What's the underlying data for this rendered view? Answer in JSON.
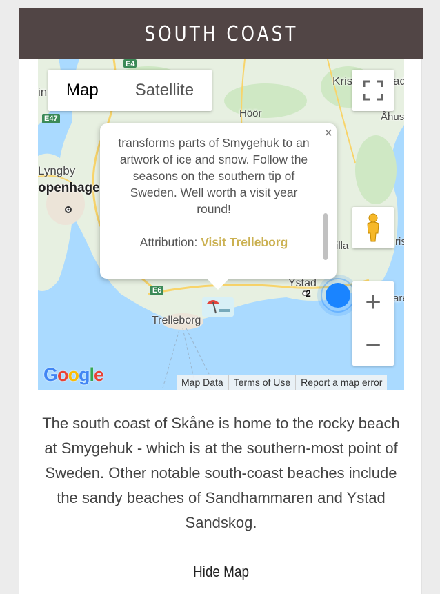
{
  "header": {
    "title": "SOUTH COAST"
  },
  "map": {
    "map_type": {
      "map_label": "Map",
      "satellite_label": "Satellite",
      "active": "Map"
    },
    "controls": {
      "fullscreen_icon": "fullscreen-icon",
      "pegman_icon": "pegman-icon",
      "zoom_in": "+",
      "zoom_out": "−"
    },
    "popup": {
      "text": "transforms parts of Smygehuk to an artwork of ice and snow. Follow the seasons on the southern tip of Sweden. Well worth a visit year round!",
      "attribution_label": "Attribution:",
      "attribution_link": "Visit Trelleborg",
      "close": "×",
      "link_color": "#cbb152"
    },
    "labels": {
      "kris": "Kris",
      "ad": "ad",
      "in": "in",
      "hoor": "Höör",
      "ahus": "Åhus",
      "lyngby": "Lyngby",
      "copenhagen": "openhage",
      "illa": "illa",
      "ris": "ris",
      "ystad": "Ystad",
      "trelleborg": "Trelleborg",
      "are": "are",
      "cluster_count": "2"
    },
    "road_shields": {
      "e47": "E47",
      "e6": "E6",
      "e4": "E4"
    },
    "footer": {
      "map_data": "Map Data",
      "terms": "Terms of Use",
      "report": "Report a map error"
    },
    "logo": "Google",
    "colors": {
      "water": "#aadaff",
      "land": "#e7f0e1",
      "road": "#f8d46a",
      "cluster": "#1a84ff"
    }
  },
  "description": "The south coast of Skåne is home to the rocky beach at Smygehuk - which is at the southern-most point of Sweden. Other notable south-coast beaches include the sandy beaches of Sandhammaren and Ystad Sandskog.",
  "hide_map_label": "Hide Map",
  "colors": {
    "header_bg": "#514545",
    "page_bg": "#ececec"
  }
}
